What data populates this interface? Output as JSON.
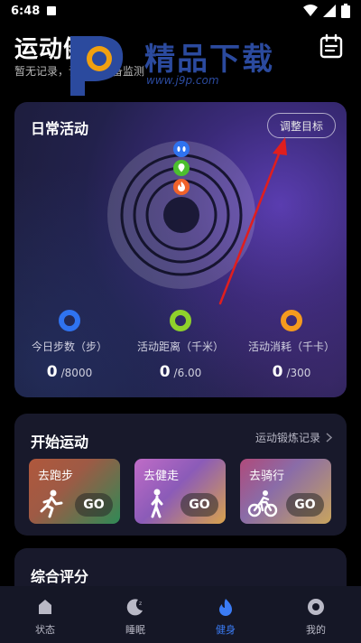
{
  "status_bar": {
    "time": "6:48"
  },
  "header": {
    "title": "运动健身",
    "subtitle": "暂无记录，请佩戴设备监测"
  },
  "watermark": {
    "text": "精品下载",
    "url": "www.j9p.com"
  },
  "daily_activity": {
    "title": "日常活动",
    "adjust_button": "调整目标",
    "metrics": [
      {
        "label": "今日步数（步）",
        "value": "0",
        "goal": "/8000",
        "color": "#2f73f0"
      },
      {
        "label": "活动距离（千米）",
        "value": "0",
        "goal": "/6.00",
        "color": "#8fd12b"
      },
      {
        "label": "活动消耗（千卡）",
        "value": "0",
        "goal": "/300",
        "color": "#f59a1e"
      }
    ]
  },
  "start_workout": {
    "title": "开始运动",
    "records_link": "运动锻炼记录",
    "tiles": [
      {
        "name": "去跑步",
        "go": "GO",
        "icon": "running-icon"
      },
      {
        "name": "去健走",
        "go": "GO",
        "icon": "walking-icon"
      },
      {
        "name": "去骑行",
        "go": "GO",
        "icon": "cycling-icon"
      }
    ]
  },
  "score": {
    "title": "综合评分"
  },
  "bottom_nav": {
    "items": [
      {
        "label": "状态",
        "icon": "home-icon"
      },
      {
        "label": "睡眠",
        "icon": "moon-icon"
      },
      {
        "label": "健身",
        "icon": "flame-icon"
      },
      {
        "label": "我的",
        "icon": "profile-icon"
      }
    ],
    "active_index": 2
  },
  "colors": {
    "accent": "#3b7cf5",
    "steps_ring": "#2f73f0",
    "distance_ring": "#8fd12b",
    "calorie_ring": "#f59a1e",
    "annotation_arrow": "#e01e1e"
  }
}
